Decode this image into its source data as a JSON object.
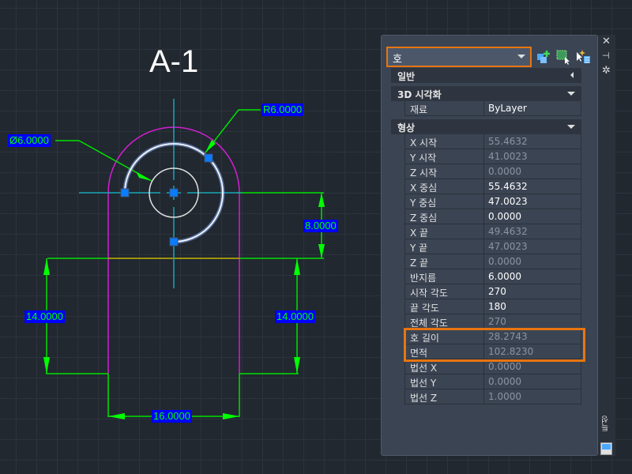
{
  "drawing": {
    "title": "A-1",
    "dims": {
      "diameter": "Ø6.0000",
      "radius": "R6.0000",
      "vertical_right_top": "8.0000",
      "left_height": "14.0000",
      "right_height": "14.0000",
      "bottom_width": "16.0000"
    },
    "colors": {
      "outline": "#d21fd2",
      "dimension": "#00ff00",
      "centerline": "#19a5b4",
      "selected_arc": "#e8f0ff",
      "grip": "#0a7cff",
      "yellow_line": "#c8b400"
    }
  },
  "panel": {
    "object_type": "호",
    "toolbar": [
      "quick-select-icon",
      "select-objects-icon",
      "toggle-pickadd-icon"
    ],
    "sections": [
      {
        "label": "일반",
        "collapsed": true,
        "rows": []
      },
      {
        "label": "3D 시각화",
        "collapsed": false,
        "rows": [
          {
            "k": "재료",
            "v": "ByLayer",
            "ro": false
          }
        ]
      },
      {
        "label": "형상",
        "collapsed": false,
        "rows": [
          {
            "k": "X 시작",
            "v": "55.4632",
            "ro": true
          },
          {
            "k": "Y 시작",
            "v": "41.0023",
            "ro": true
          },
          {
            "k": "Z 시작",
            "v": "0.0000",
            "ro": true
          },
          {
            "k": "X 중심",
            "v": "55.4632",
            "ro": false
          },
          {
            "k": "Y 중심",
            "v": "47.0023",
            "ro": false
          },
          {
            "k": "Z 중심",
            "v": "0.0000",
            "ro": false
          },
          {
            "k": "X 끝",
            "v": "49.4632",
            "ro": true
          },
          {
            "k": "Y 끝",
            "v": "47.0023",
            "ro": true
          },
          {
            "k": "Z 끝",
            "v": "0.0000",
            "ro": true
          },
          {
            "k": "반지름",
            "v": "6.0000",
            "ro": false
          },
          {
            "k": "시작 각도",
            "v": "270",
            "ro": false
          },
          {
            "k": "끝 각도",
            "v": "180",
            "ro": false
          },
          {
            "k": "전체 각도",
            "v": "270",
            "ro": true
          },
          {
            "k": "호 길이",
            "v": "28.2743",
            "ro": true
          },
          {
            "k": "면적",
            "v": "102.8230",
            "ro": true
          },
          {
            "k": "법선 X",
            "v": "0.0000",
            "ro": true
          },
          {
            "k": "법선 Y",
            "v": "0.0000",
            "ro": true
          },
          {
            "k": "법선 Z",
            "v": "1.0000",
            "ro": true
          }
        ]
      }
    ],
    "side_label": "특성",
    "highlight_color": "#e8750f"
  }
}
